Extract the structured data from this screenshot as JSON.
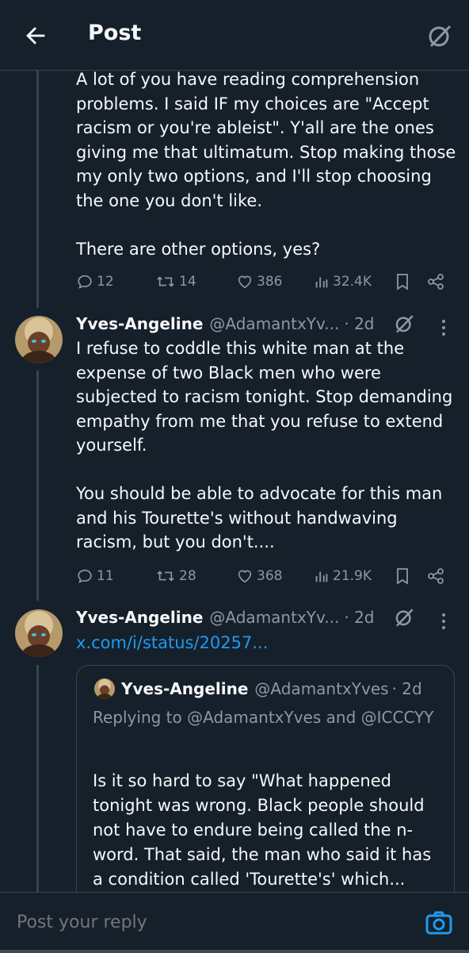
{
  "header": {
    "title": "Post"
  },
  "tweet1": {
    "text": "A lot of you have reading comprehension problems. I said IF my choices are \"Accept racism or you're ableist\". Y'all are the ones giving me that ultimatum. Stop making those my only two options, and I'll stop choosing the one you don't like.\n\nThere are other options, yes?",
    "replies": "12",
    "reposts": "14",
    "likes": "386",
    "views": "32.4K"
  },
  "tweet2": {
    "name": "Yves-Angeline",
    "handle": "@AdamantxYv...",
    "time": "· 2d",
    "text": "I refuse to coddle this white man at the expense of two Black men who were subjected to racism tonight. Stop demanding empathy from me that you refuse to extend yourself.\n\nYou should be able to advocate for this man and his Tourette's without handwaving racism, but you don't....",
    "replies": "11",
    "reposts": "28",
    "likes": "368",
    "views": "21.9K"
  },
  "tweet3": {
    "name": "Yves-Angeline",
    "handle": "@AdamantxYv...",
    "time": "· 2d",
    "link": "x.com/i/status/20257..."
  },
  "quote": {
    "name": "Yves-Angeline",
    "handle": "@AdamantxYves",
    "time": "· 2d",
    "replying_prefix": "Replying to ",
    "replying_mentions": "@AdamantxYves and @ICCCYY",
    "text": "Is it so hard to say \"What happened tonight was wrong. Black people should not have to endure being called the n-word. That said, the man who said it has a condition called 'Tourette's' which..."
  },
  "reply": {
    "placeholder": "Post your reply"
  },
  "colors": {
    "background": "#15202b",
    "accent": "#1d9bf0",
    "muted": "#8b98a5",
    "border": "#38444d"
  }
}
